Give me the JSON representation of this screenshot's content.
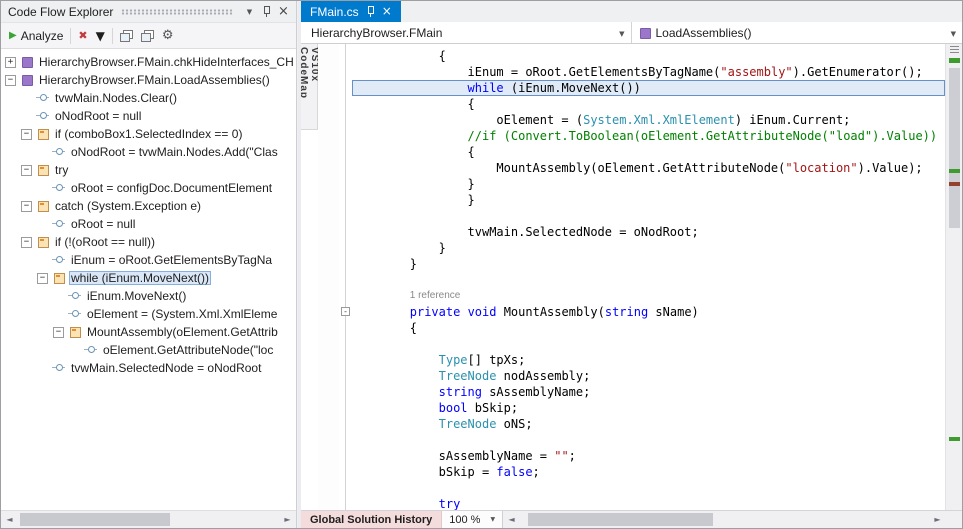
{
  "left_panel": {
    "title": "Code Flow Explorer",
    "toolbar": {
      "analyze": "Analyze"
    },
    "tree": [
      {
        "label": "HierarchyBrowser.FMain.chkHideInterfaces_CH",
        "level": 0,
        "exp": "+",
        "icon": "method"
      },
      {
        "label": "HierarchyBrowser.FMain.LoadAssemblies()",
        "level": 0,
        "exp": "-",
        "icon": "method"
      },
      {
        "label": "tvwMain.Nodes.Clear()",
        "level": 1,
        "icon": "stmt"
      },
      {
        "label": "oNodRoot = null",
        "level": 1,
        "icon": "stmt"
      },
      {
        "label": "if (comboBox1.SelectedIndex == 0)",
        "level": 1,
        "exp": "-",
        "icon": "block"
      },
      {
        "label": "oNodRoot = tvwMain.Nodes.Add(\"Clas",
        "level": 2,
        "icon": "stmt"
      },
      {
        "label": "try",
        "level": 1,
        "exp": "-",
        "icon": "block"
      },
      {
        "label": "oRoot = configDoc.DocumentElement",
        "level": 2,
        "icon": "stmt"
      },
      {
        "label": "catch (System.Exception e)",
        "level": 1,
        "exp": "-",
        "icon": "block"
      },
      {
        "label": "oRoot = null",
        "level": 2,
        "icon": "stmt"
      },
      {
        "label": "if (!(oRoot == null))",
        "level": 1,
        "exp": "-",
        "icon": "block"
      },
      {
        "label": "iEnum = oRoot.GetElementsByTagNa",
        "level": 2,
        "icon": "stmt"
      },
      {
        "label": "while (iEnum.MoveNext())",
        "level": 2,
        "exp": "-",
        "icon": "block",
        "sel": true
      },
      {
        "label": "iEnum.MoveNext()",
        "level": 3,
        "icon": "stmt"
      },
      {
        "label": "oElement = (System.Xml.XmlEleme",
        "level": 3,
        "icon": "stmt"
      },
      {
        "label": "MountAssembly(oElement.GetAttrib",
        "level": 3,
        "exp": "-",
        "icon": "block"
      },
      {
        "label": "oElement.GetAttributeNode(\"loc",
        "level": 4,
        "icon": "stmt"
      },
      {
        "label": "tvwMain.SelectedNode = oNodRoot",
        "level": 2,
        "icon": "stmt"
      }
    ]
  },
  "editor": {
    "tab_label": "FMain.cs",
    "navbar": {
      "type_name": "HierarchyBrowser.FMain",
      "member_name": "LoadAssemblies()"
    },
    "codemap_tab": "VS10x CodeMap",
    "fold_marker": "-",
    "code_lines": [
      {
        "ind": 12,
        "seg": [
          {
            "t": "{",
            "c": "p"
          }
        ]
      },
      {
        "ind": 16,
        "seg": [
          {
            "t": "iEnum = oRoot.GetElementsByTagName(",
            "c": "p"
          },
          {
            "t": "\"assembly\"",
            "c": "s"
          },
          {
            "t": ").GetEnumerator();",
            "c": "p"
          }
        ]
      },
      {
        "ind": 16,
        "hl": true,
        "seg": [
          {
            "t": "while",
            "c": "k"
          },
          {
            "t": " (iEnum.MoveNext())",
            "c": "p"
          }
        ]
      },
      {
        "ind": 16,
        "seg": [
          {
            "t": "{",
            "c": "p"
          }
        ]
      },
      {
        "ind": 20,
        "seg": [
          {
            "t": "oElement = (",
            "c": "p"
          },
          {
            "t": "System.Xml.XmlElement",
            "c": "t"
          },
          {
            "t": ") iEnum.Current;",
            "c": "p"
          }
        ]
      },
      {
        "ind": 16,
        "seg": [
          {
            "t": "//if (Convert.ToBoolean(oElement.GetAttributeNode(\"load\").Value))",
            "c": "c"
          }
        ]
      },
      {
        "ind": 16,
        "seg": [
          {
            "t": "{",
            "c": "p"
          }
        ]
      },
      {
        "ind": 20,
        "seg": [
          {
            "t": "MountAssembly(oElement.GetAttributeNode(",
            "c": "p"
          },
          {
            "t": "\"location\"",
            "c": "s"
          },
          {
            "t": ").Value);",
            "c": "p"
          }
        ]
      },
      {
        "ind": 16,
        "seg": [
          {
            "t": "}",
            "c": "p"
          }
        ]
      },
      {
        "ind": 16,
        "seg": [
          {
            "t": "}",
            "c": "p"
          }
        ]
      },
      {
        "ind": 0,
        "seg": []
      },
      {
        "ind": 16,
        "seg": [
          {
            "t": "tvwMain.SelectedNode = oNodRoot;",
            "c": "p"
          }
        ]
      },
      {
        "ind": 12,
        "seg": [
          {
            "t": "}",
            "c": "p"
          }
        ]
      },
      {
        "ind": 8,
        "seg": [
          {
            "t": "}",
            "c": "p"
          }
        ]
      },
      {
        "ind": 0,
        "seg": []
      },
      {
        "ind": 8,
        "ref": true,
        "seg": [
          {
            "t": "1 reference",
            "c": "g"
          }
        ]
      },
      {
        "ind": 8,
        "fold": true,
        "seg": [
          {
            "t": "private",
            "c": "k"
          },
          {
            "t": " ",
            "c": "p"
          },
          {
            "t": "void",
            "c": "k"
          },
          {
            "t": " MountAssembly(",
            "c": "p"
          },
          {
            "t": "string",
            "c": "k"
          },
          {
            "t": " sName)",
            "c": "p"
          }
        ]
      },
      {
        "ind": 8,
        "seg": [
          {
            "t": "{",
            "c": "p"
          }
        ]
      },
      {
        "ind": 0,
        "seg": []
      },
      {
        "ind": 12,
        "seg": [
          {
            "t": "Type",
            "c": "t"
          },
          {
            "t": "[] tpXs;",
            "c": "p"
          }
        ]
      },
      {
        "ind": 12,
        "seg": [
          {
            "t": "TreeNode",
            "c": "t"
          },
          {
            "t": " nodAssembly;",
            "c": "p"
          }
        ]
      },
      {
        "ind": 12,
        "seg": [
          {
            "t": "string",
            "c": "k"
          },
          {
            "t": " sAssemblyName;",
            "c": "p"
          }
        ]
      },
      {
        "ind": 12,
        "seg": [
          {
            "t": "bool",
            "c": "k"
          },
          {
            "t": " bSkip;",
            "c": "p"
          }
        ]
      },
      {
        "ind": 12,
        "seg": [
          {
            "t": "TreeNode",
            "c": "t"
          },
          {
            "t": " oNS;",
            "c": "p"
          }
        ]
      },
      {
        "ind": 0,
        "seg": []
      },
      {
        "ind": 12,
        "seg": [
          {
            "t": "sAssemblyName = ",
            "c": "p"
          },
          {
            "t": "\"\"",
            "c": "s"
          },
          {
            "t": ";",
            "c": "p"
          }
        ]
      },
      {
        "ind": 12,
        "seg": [
          {
            "t": "bSkip = ",
            "c": "p"
          },
          {
            "t": "false",
            "c": "k"
          },
          {
            "t": ";",
            "c": "p"
          }
        ]
      },
      {
        "ind": 0,
        "seg": []
      },
      {
        "ind": 12,
        "seg": [
          {
            "t": "try",
            "c": "k"
          }
        ]
      }
    ],
    "bottom": {
      "history": "Global Solution History",
      "zoom": "100 %"
    }
  }
}
